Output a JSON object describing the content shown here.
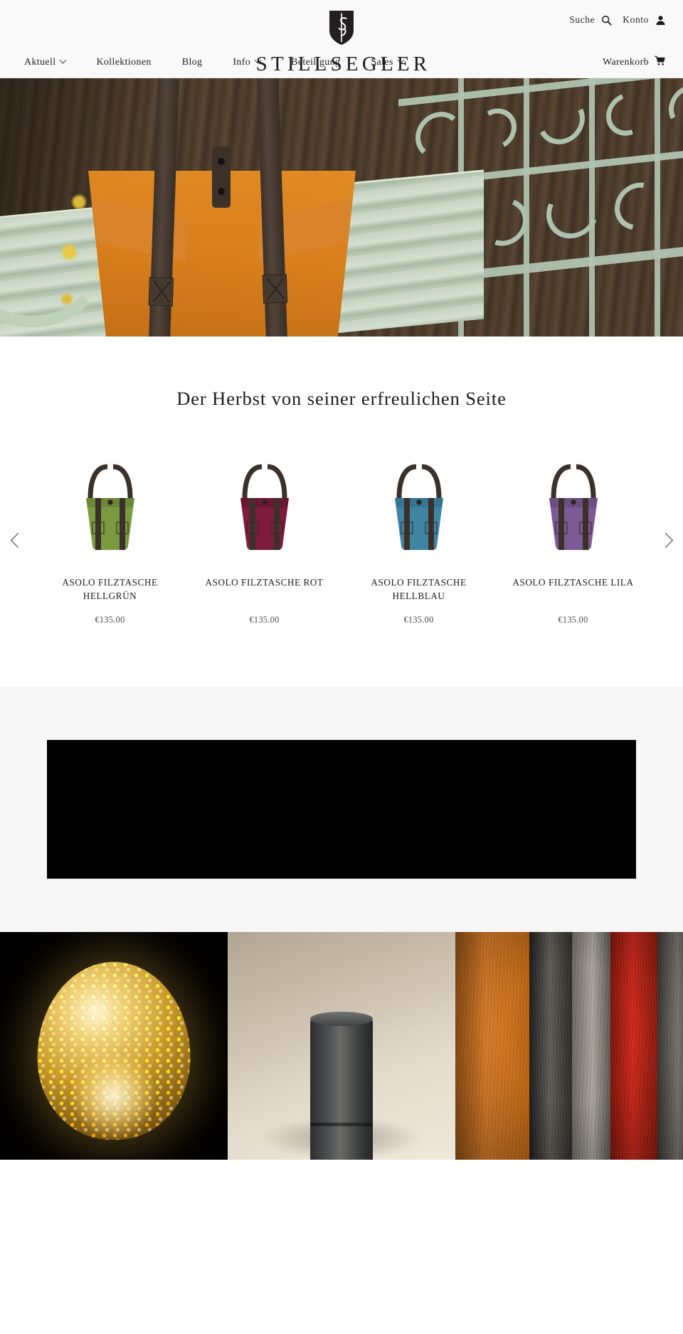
{
  "header": {
    "brand_name": "STILLSEGLER",
    "logo_icon": "shield-s-logo",
    "utility": {
      "search_label": "Suche",
      "search_icon": "search-icon",
      "account_label": "Konto",
      "account_icon": "user-icon"
    },
    "nav_items": [
      {
        "label": "Aktuell",
        "has_dropdown": true
      },
      {
        "label": "Kollektionen",
        "has_dropdown": false
      },
      {
        "label": "Blog",
        "has_dropdown": false
      },
      {
        "label": "Info",
        "has_dropdown": true
      },
      {
        "label": "Beteiligung",
        "has_dropdown": false
      },
      {
        "label": "Sales",
        "has_dropdown": true
      }
    ],
    "cart": {
      "label": "Warenkorb",
      "icon": "shopping-cart-icon"
    }
  },
  "hero": {
    "alt": "Orange Filztasche auf einer salbeigrünen Gartenbank",
    "bag_color": "#d9832a",
    "bench_color": "#bfd0bb"
  },
  "featured": {
    "title": "Der Herbst von seiner erfreulichen Seite",
    "prev_label": "Vorherige",
    "next_label": "Nächste",
    "prev_icon": "chevron-left-icon",
    "next_icon": "chevron-right-icon",
    "products": [
      {
        "name": "ASOLO FILZTASCHE HELLGRÜN",
        "price": "€135.00",
        "color": "#7a9a41",
        "color_dark": "#5d7a2e"
      },
      {
        "name": "ASOLO FILZTASCHE ROT",
        "price": "€135.00",
        "color": "#7d1c3d",
        "color_dark": "#5e1230"
      },
      {
        "name": "ASOLO FILZTASCHE HELLBLAU",
        "price": "€135.00",
        "color": "#3f85a3",
        "color_dark": "#2d6b87"
      },
      {
        "name": "ASOLO FILZTASCHE LILA",
        "price": "€135.00",
        "color": "#7c5a93",
        "color_dark": "#5f4375"
      }
    ],
    "strap_color": "#3b312a"
  },
  "video": {
    "label": "Produktvideo",
    "background": "#000000"
  },
  "tiles": [
    {
      "name": "goldene-kugellampe",
      "alt": "Goldene Kugellampe mit Noppenstruktur vor schwarzem Hintergrund"
    },
    {
      "name": "steinzylinder",
      "alt": "Dunkler Steinzylinder auf hellem Holz"
    },
    {
      "name": "filz-farben",
      "alt": "Nahaufnahme von orangem, grauem und rotem Filz"
    }
  ]
}
